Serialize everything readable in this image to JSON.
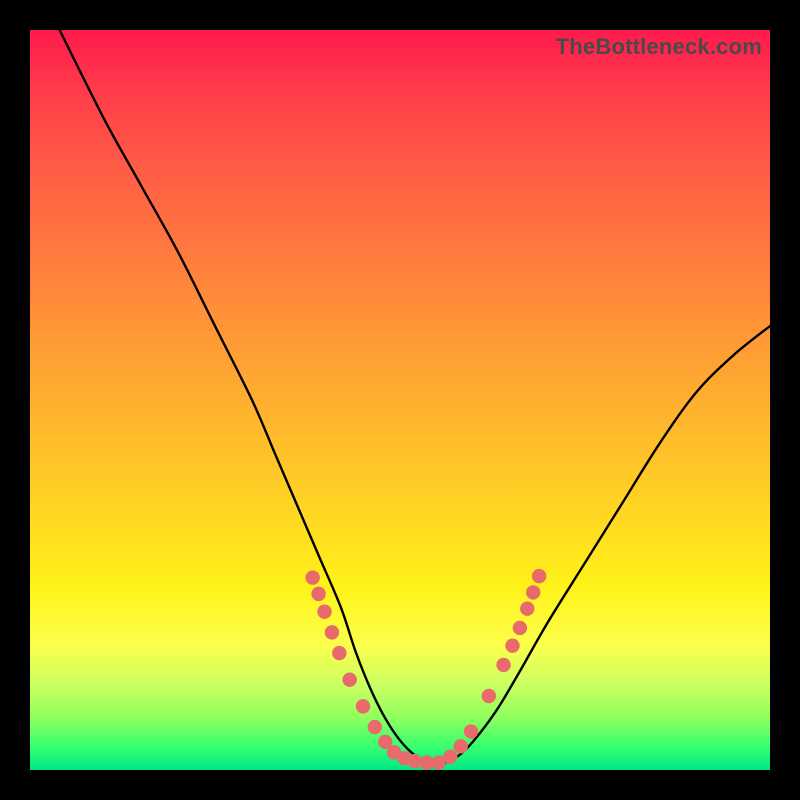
{
  "watermark": "TheBottleneck.com",
  "chart_data": {
    "type": "line",
    "title": "",
    "xlabel": "",
    "ylabel": "",
    "xlim": [
      0,
      100
    ],
    "ylim": [
      0,
      100
    ],
    "series": [
      {
        "name": "curve",
        "x": [
          4,
          10,
          15,
          20,
          25,
          30,
          33,
          36,
          39,
          42,
          44,
          46,
          48,
          50,
          52,
          54,
          56,
          58,
          60,
          63,
          66,
          70,
          75,
          80,
          85,
          90,
          95,
          100
        ],
        "y": [
          100,
          88,
          79,
          70,
          60,
          50,
          43,
          36,
          29,
          22,
          16,
          11,
          7,
          4,
          2,
          1,
          1,
          2,
          4,
          8,
          13,
          20,
          28,
          36,
          44,
          51,
          56,
          60
        ]
      }
    ],
    "highlight_band": {
      "y_from": 0,
      "y_to": 20
    },
    "dots": [
      {
        "x": 38.2,
        "y": 26.0
      },
      {
        "x": 39.0,
        "y": 23.8
      },
      {
        "x": 39.8,
        "y": 21.4
      },
      {
        "x": 40.8,
        "y": 18.6
      },
      {
        "x": 41.8,
        "y": 15.8
      },
      {
        "x": 43.2,
        "y": 12.2
      },
      {
        "x": 45.0,
        "y": 8.6
      },
      {
        "x": 46.6,
        "y": 5.8
      },
      {
        "x": 48.0,
        "y": 3.8
      },
      {
        "x": 49.2,
        "y": 2.4
      },
      {
        "x": 50.6,
        "y": 1.6
      },
      {
        "x": 52.0,
        "y": 1.2
      },
      {
        "x": 53.6,
        "y": 1.0
      },
      {
        "x": 55.2,
        "y": 1.0
      },
      {
        "x": 56.8,
        "y": 1.8
      },
      {
        "x": 58.2,
        "y": 3.2
      },
      {
        "x": 59.6,
        "y": 5.2
      },
      {
        "x": 62.0,
        "y": 10.0
      },
      {
        "x": 64.0,
        "y": 14.2
      },
      {
        "x": 65.2,
        "y": 16.8
      },
      {
        "x": 66.2,
        "y": 19.2
      },
      {
        "x": 67.2,
        "y": 21.8
      },
      {
        "x": 68.0,
        "y": 24.0
      },
      {
        "x": 68.8,
        "y": 26.2
      }
    ]
  }
}
